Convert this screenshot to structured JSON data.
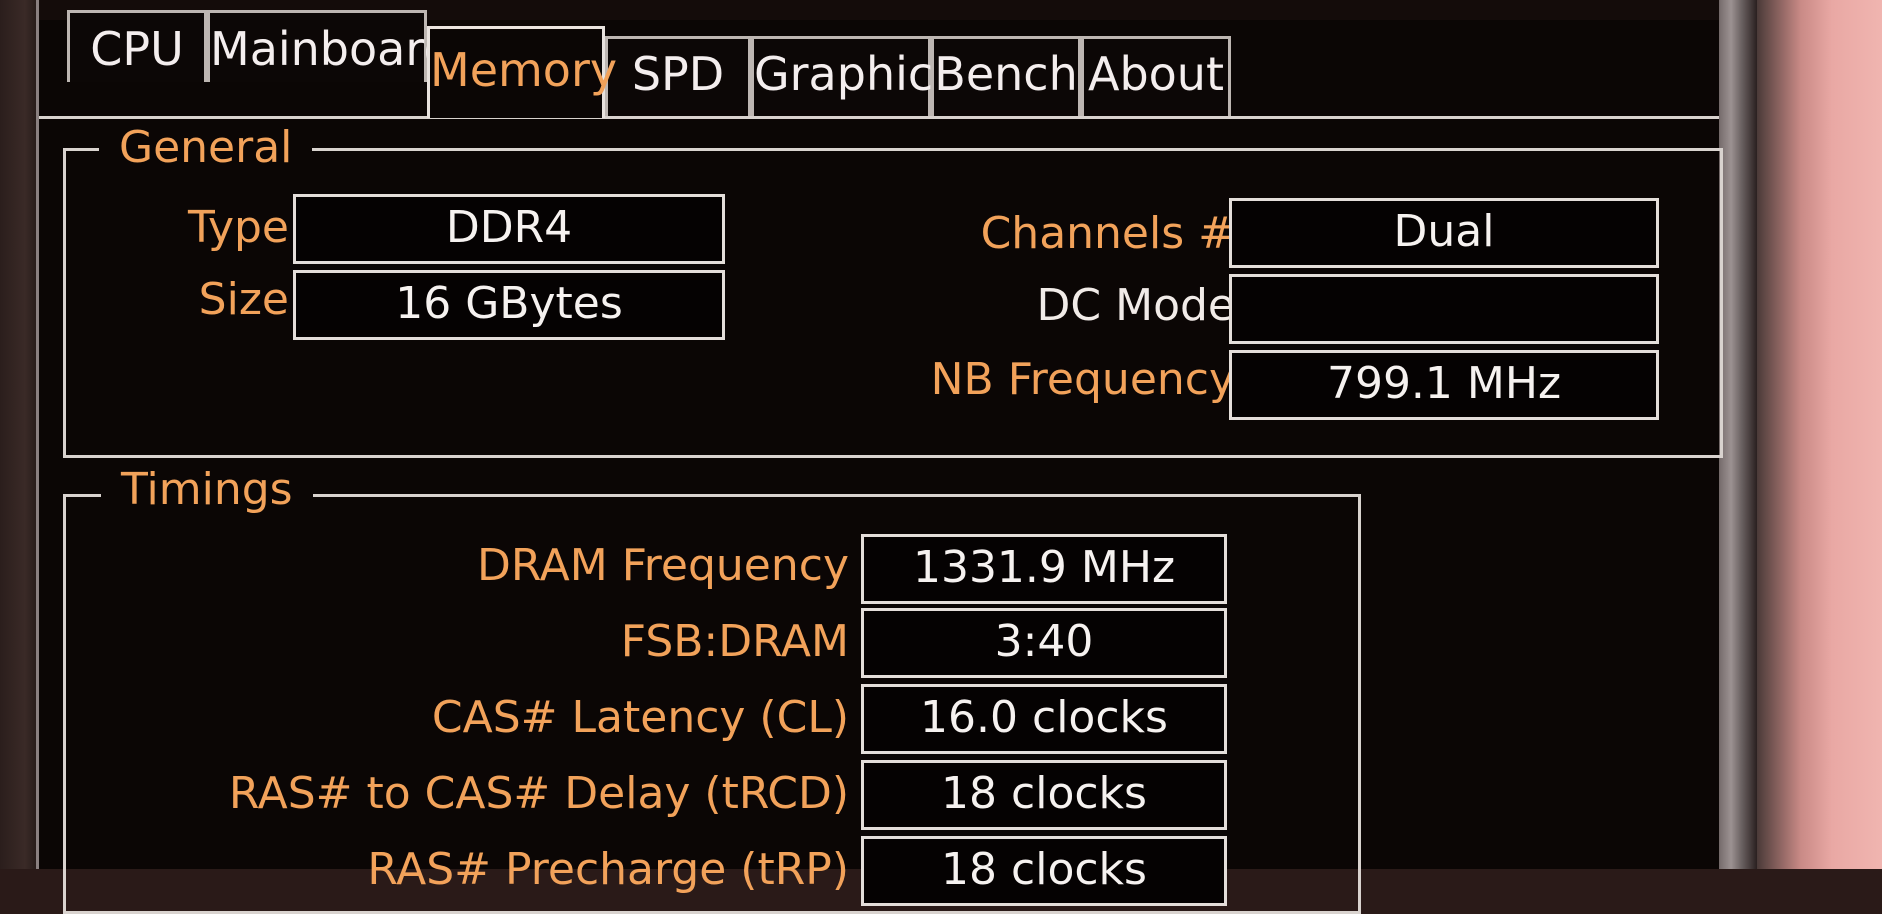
{
  "tabs": [
    "CPU",
    "Mainboard",
    "Memory",
    "SPD",
    "Graphics",
    "Bench",
    "About"
  ],
  "general": {
    "title": "General",
    "type_label": "Type",
    "type_value": "DDR4",
    "size_label": "Size",
    "size_value": "16 GBytes",
    "channels_label": "Channels #",
    "channels_value": "Dual",
    "dcmode_label": "DC Mode",
    "dcmode_value": "",
    "nbfreq_label": "NB Frequency",
    "nbfreq_value": "799.1 MHz"
  },
  "timings": {
    "title": "Timings",
    "rows": [
      {
        "label": "DRAM Frequency",
        "value": "1331.9 MHz"
      },
      {
        "label": "FSB:DRAM",
        "value": "3:40"
      },
      {
        "label": "CAS# Latency (CL)",
        "value": "16.0 clocks"
      },
      {
        "label": "RAS# to CAS# Delay (tRCD)",
        "value": "18 clocks"
      },
      {
        "label": "RAS# Precharge (tRP)",
        "value": "18 clocks"
      }
    ]
  },
  "colors": {
    "accent": "#f2a25a",
    "text": "#f6f2f0",
    "background": "#0b0605"
  }
}
